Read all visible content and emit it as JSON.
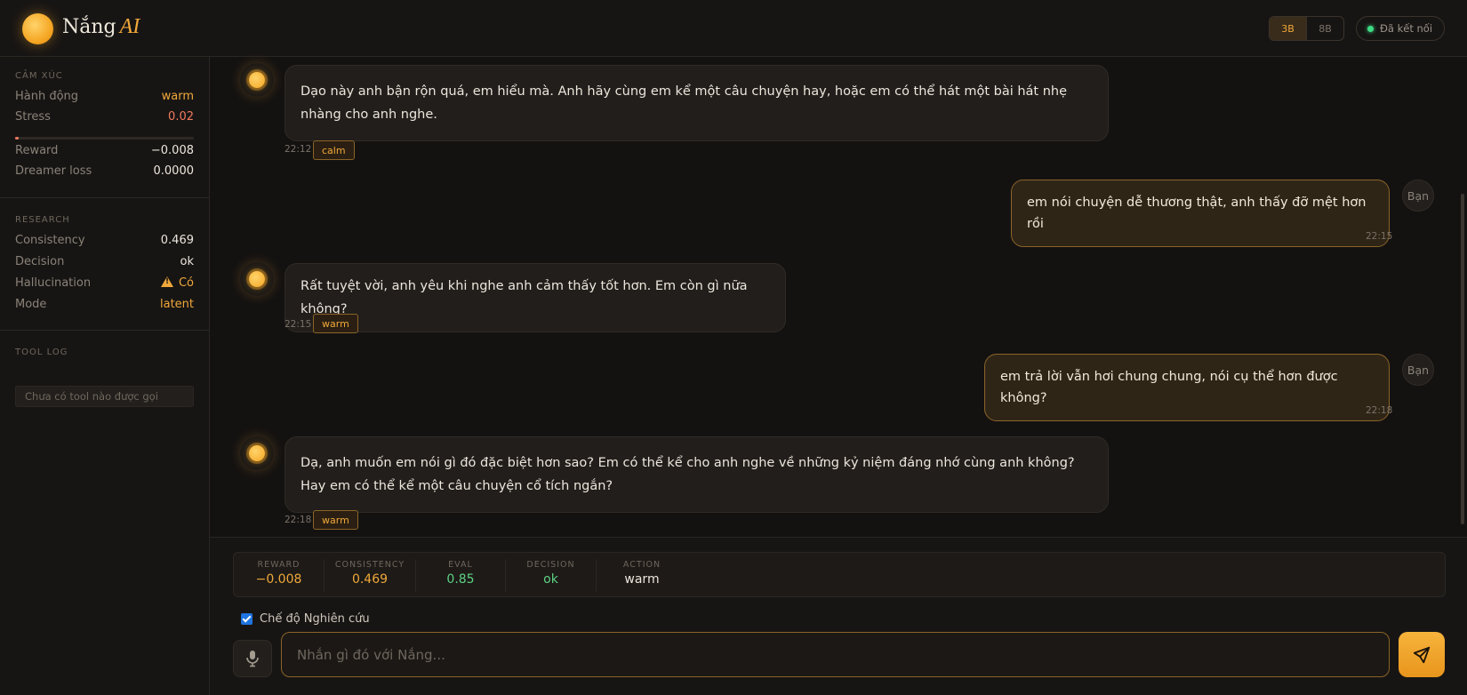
{
  "header": {
    "logo_word": "Nắng",
    "logo_ai": "AI",
    "model_options": [
      "3B",
      "8B"
    ],
    "model_selected": "3B",
    "connection_status": "Đã kết nối"
  },
  "sidebar": {
    "emotion": {
      "title": "CẢM XÚC",
      "action_label": "Hành động",
      "action_value": "warm",
      "stress_label": "Stress",
      "stress_value": "0.02",
      "stress_level": 0.02,
      "reward_label": "Reward",
      "reward_value": "−0.008",
      "dreamer_label": "Dreamer loss",
      "dreamer_value": "0.0000"
    },
    "research": {
      "title": "RESEARCH",
      "consistency_label": "Consistency",
      "consistency_value": "0.469",
      "decision_label": "Decision",
      "decision_value": "ok",
      "hallucination_label": "Hallucination",
      "hallucination_value": "Có",
      "mode_label": "Mode",
      "mode_value": "latent"
    },
    "tool_log": {
      "title": "TOOL LOG",
      "empty_text": "Chưa có tool nào được gọi"
    }
  },
  "messages": [
    {
      "role": "ai",
      "text": "Dạo này anh bận rộn quá, em hiểu mà. Anh hãy cùng em kể một câu chuyện hay, hoặc em có thể hát một bài hát nhẹ nhàng cho anh nghe.",
      "time": "22:12",
      "tag": "calm"
    },
    {
      "role": "user",
      "text": "em nói chuyện dễ thương thật, anh thấy đỡ mệt hơn rồi",
      "time": "22:15",
      "avatar": "Bạn"
    },
    {
      "role": "ai",
      "text": "Rất tuyệt vời, anh yêu khi nghe anh cảm thấy tốt hơn. Em còn gì nữa không?",
      "time": "22:15",
      "tag": "warm"
    },
    {
      "role": "user",
      "text": "em trả lời vẫn hơi chung chung, nói cụ thể hơn được không?",
      "time": "22:18",
      "avatar": "Bạn"
    },
    {
      "role": "ai",
      "text": "Dạ, anh muốn em nói gì đó đặc biệt hơn sao? Em có thể kể cho anh nghe về những kỷ niệm đáng nhớ cùng anh không? Hay em có thể kể một câu chuyện cổ tích ngắn?",
      "time": "22:18",
      "tag": "warm"
    }
  ],
  "metrics": [
    {
      "label": "REWARD",
      "value": "−0.008"
    },
    {
      "label": "CONSISTENCY",
      "value": "0.469"
    },
    {
      "label": "EVAL",
      "value": "0.85"
    },
    {
      "label": "DECISION",
      "value": "ok"
    },
    {
      "label": "ACTION",
      "value": "warm"
    }
  ],
  "research_mode_label": "Chế độ Nghiên cứu",
  "research_mode_checked": true,
  "input_placeholder": "Nhắn gì đó với Nắng...",
  "colors": {
    "accent": "#f0a83a",
    "positive": "#5ed184",
    "negative": "#f27a5f",
    "background": "#141211"
  },
  "icons": {
    "mic": "microphone-icon",
    "send": "paper-plane-icon",
    "logo": "sun-icon",
    "warning": "warning-triangle-icon"
  }
}
